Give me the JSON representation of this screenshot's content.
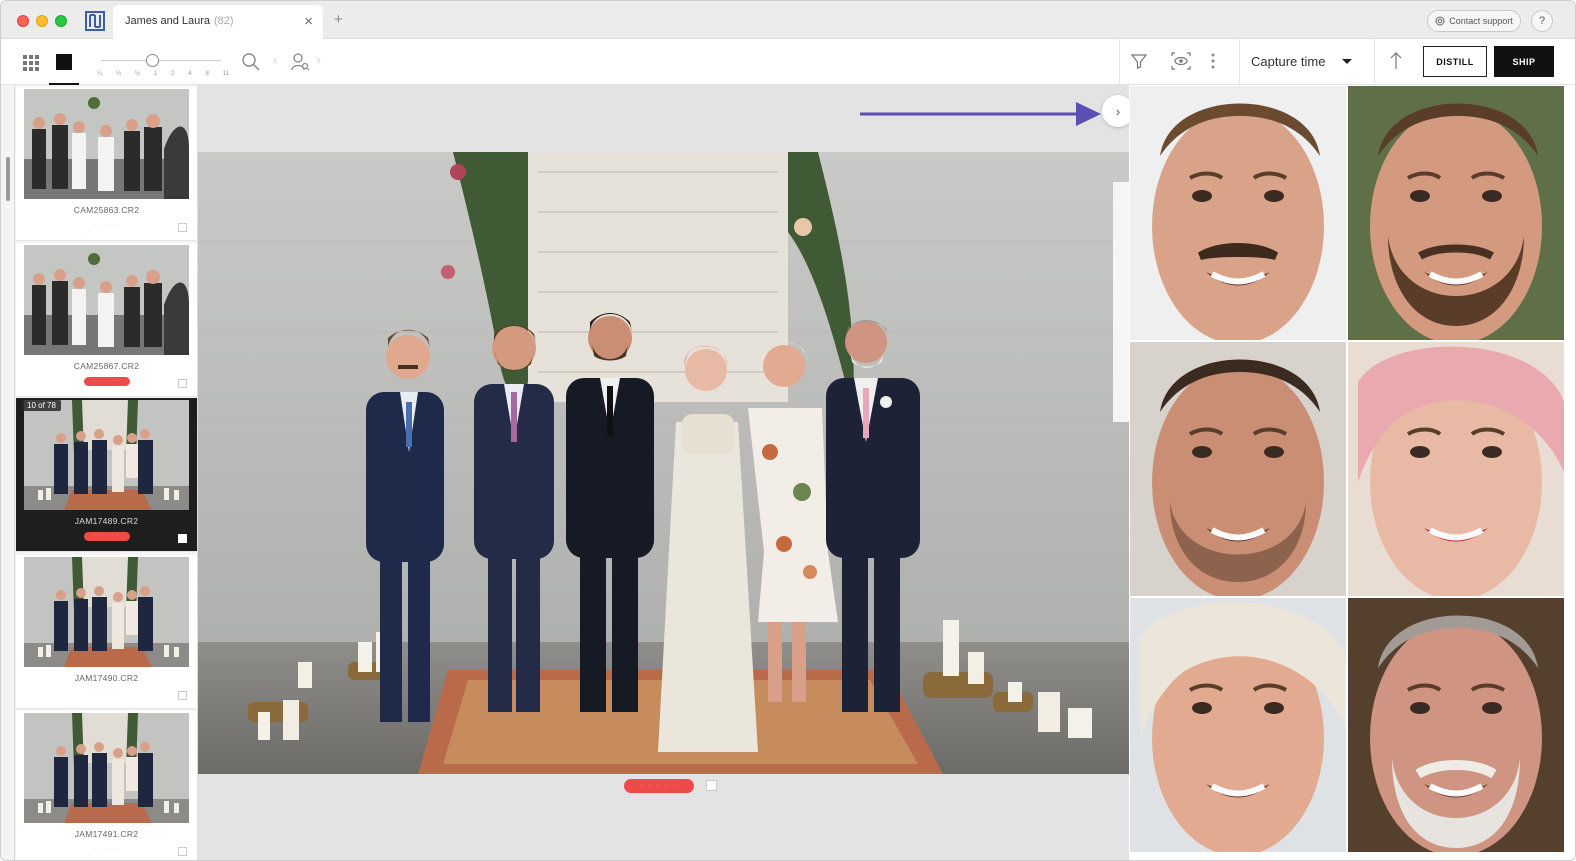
{
  "window": {
    "tab_title": "James and Laura",
    "tab_count": "(82)",
    "tab_close": "×",
    "new_tab": "+",
    "contact_support": "Contact support",
    "help": "?"
  },
  "toolbar": {
    "zoom_levels": [
      "¼",
      "⅓",
      "½",
      "1",
      "2",
      "4",
      "8",
      "11"
    ],
    "sort_label": "Capture time",
    "distill_label": "DISTILL",
    "ship_label": "SHIP"
  },
  "filmstrip": {
    "items": [
      {
        "name": "CAM25863.CR2",
        "rating": "· · · · ·",
        "rated": false,
        "selected": false,
        "scene": "crowd"
      },
      {
        "name": "CAM25867.CR2",
        "rating": "· · · · ·",
        "rated": true,
        "selected": false,
        "scene": "crowd"
      },
      {
        "name": "JAM17489.CR2",
        "rating": "· · · · ·",
        "rated": true,
        "selected": true,
        "scene": "group",
        "badge": "10 of 78"
      },
      {
        "name": "JAM17490.CR2",
        "rating": "· · · · ·",
        "rated": false,
        "selected": false,
        "scene": "group"
      },
      {
        "name": "JAM17491.CR2",
        "rating": "· · · · ·",
        "rated": false,
        "selected": false,
        "scene": "group"
      }
    ]
  },
  "viewer": {
    "rating": "· · · · ·",
    "toggle_glyph": "›"
  },
  "faces": [
    {
      "person": "man-mustache",
      "skin": "#d9a389",
      "hair": "#6b4a30",
      "beard": "mustache",
      "bg": "#efefef"
    },
    {
      "person": "man-beard",
      "skin": "#d49a80",
      "hair": "#5a3d28",
      "beard": "full",
      "bg": "#5f7049"
    },
    {
      "person": "man-stubble",
      "skin": "#c98e74",
      "hair": "#3a2a20",
      "beard": "stubble",
      "bg": "#d7d2cc"
    },
    {
      "person": "woman-pink-hair",
      "skin": "#e8b9a4",
      "hair": "#e9a9ae",
      "beard": "none",
      "bg": "#e9dcd2"
    },
    {
      "person": "woman-blonde",
      "skin": "#e2aa90",
      "hair": "#ece6da",
      "beard": "none",
      "bg": "#dfe2e4"
    },
    {
      "person": "older-man-white-beard",
      "skin": "#cf9482",
      "hair": "#a29b95",
      "beard": "white",
      "bg": "#55402e"
    }
  ],
  "colors": {
    "accent_red": "#ef4a4a",
    "annotation_arrow": "#5b4fb3",
    "ship_bg": "#111111"
  }
}
